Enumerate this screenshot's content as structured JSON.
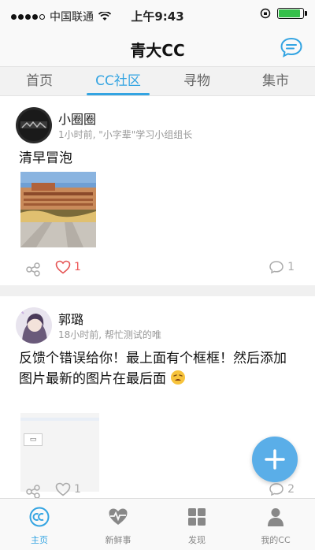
{
  "status_bar": {
    "carrier": "中国联通",
    "time": "上午9:43",
    "battery_level": 0.9
  },
  "nav": {
    "title": "青大CC",
    "right_icon": "chat-bubble-icon"
  },
  "tabs": [
    {
      "label": "首页",
      "active": false
    },
    {
      "label": "CC社区",
      "active": true
    },
    {
      "label": "寻物",
      "active": false
    },
    {
      "label": "集市",
      "active": false
    }
  ],
  "posts": [
    {
      "author": "小圈圈",
      "meta": "1小时前, \"小字辈\"学习小组组长",
      "text": "清早冒泡",
      "likes": "1",
      "comments": "1",
      "liked": true
    },
    {
      "author": "郭璐",
      "meta": "18小时前, 帮忙测试的唯",
      "text": "反馈个错误给你！最上面有个框框！然后添加图片最新的图片在最后面",
      "likes": "1",
      "comments": "2",
      "liked": false
    }
  ],
  "tab_bar": [
    {
      "label": "主页",
      "icon": "cc-icon",
      "active": true
    },
    {
      "label": "新鲜事",
      "icon": "heartbeat-icon",
      "active": false
    },
    {
      "label": "发现",
      "icon": "grid-icon",
      "active": false
    },
    {
      "label": "我的CC",
      "icon": "person-icon",
      "active": false
    }
  ],
  "colors": {
    "accent": "#33a4e2",
    "fab": "#5aaee8",
    "like": "#e55555"
  }
}
